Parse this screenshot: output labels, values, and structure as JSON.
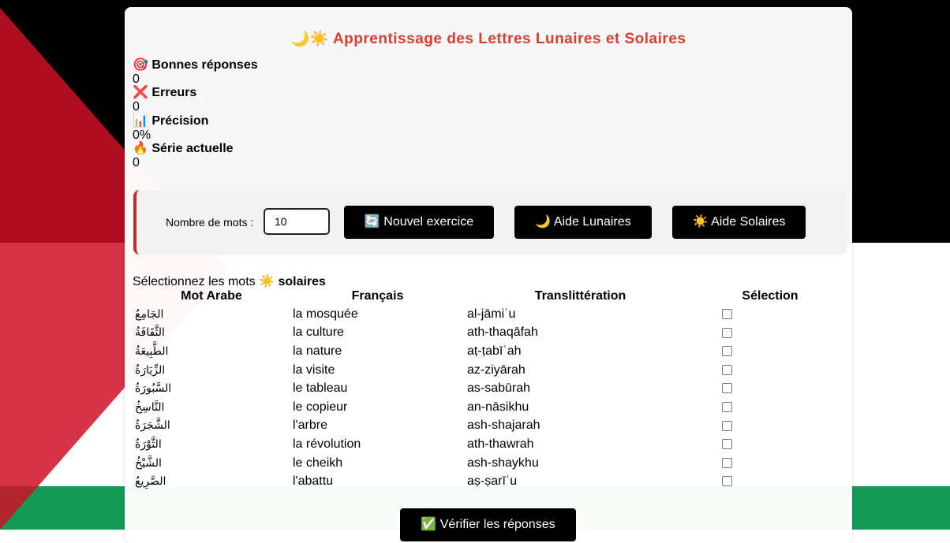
{
  "title": "🌙☀️ Apprentissage des Lettres Lunaires et Solaires",
  "stats": [
    {
      "label": "🎯 Bonnes réponses",
      "value": "0"
    },
    {
      "label": "❌ Erreurs",
      "value": "0"
    },
    {
      "label": "📊 Précision",
      "value": "0%"
    },
    {
      "label": "🔥 Série actuelle",
      "value": "0"
    }
  ],
  "controls": {
    "count_label": "Nombre de mots :",
    "count_value": "10",
    "new_exercise": "🔄 Nouvel exercice",
    "help_lunar": "🌙 Aide Lunaires",
    "help_solar": "☀️ Aide Solaires"
  },
  "instruction": {
    "prefix": "Sélectionnez les mots ☀️",
    "emphasis": "solaires"
  },
  "table": {
    "headers": [
      "Mot Arabe",
      "Français",
      "Translittération",
      "Sélection"
    ],
    "rows": [
      {
        "arabic": "الجَامِعُ",
        "french": "la mosquée",
        "translit": "al-jāmiʿu"
      },
      {
        "arabic": "الثَّقَافَةُ",
        "french": "la culture",
        "translit": "ath-thaqāfah"
      },
      {
        "arabic": "الطَّبِيعَةُ",
        "french": "la nature",
        "translit": "aṭ-ṭabīʿah"
      },
      {
        "arabic": "الزِّيَارَةُ",
        "french": "la visite",
        "translit": "az-ziyārah"
      },
      {
        "arabic": "السَّبُورَةُ",
        "french": "le tableau",
        "translit": "as-sabūrah"
      },
      {
        "arabic": "النَّاسِخُ",
        "french": "le copieur",
        "translit": "an-nāsikhu"
      },
      {
        "arabic": "الشَّجَرَةُ",
        "french": "l'arbre",
        "translit": "ash-shajarah"
      },
      {
        "arabic": "الثَّوْرَةُ",
        "french": "la révolution",
        "translit": "ath-thawrah"
      },
      {
        "arabic": "الشَّيْخُ",
        "french": "le cheikh",
        "translit": "ash-shaykhu"
      },
      {
        "arabic": "الصَّرِيعُ",
        "french": "l'abattu",
        "translit": "aṣ-ṣarīʿu"
      }
    ]
  },
  "verify_button": "✅ Vérifier les réponses",
  "colors": {
    "title": "#dc3c32",
    "flag_black": "#000000",
    "flag_white": "#ffffff",
    "flag_green": "#149954",
    "flag_red": "#ce1126"
  }
}
